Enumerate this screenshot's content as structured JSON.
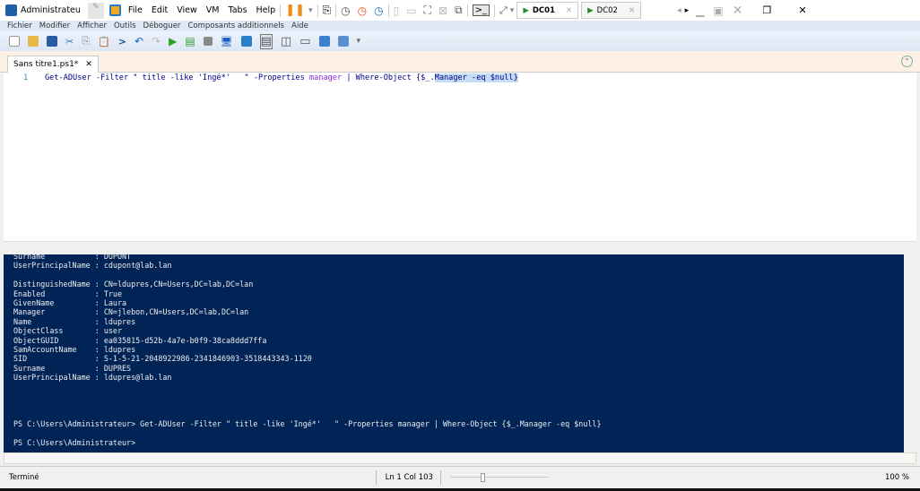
{
  "titlebar": {
    "app_title": "Administrateu",
    "menus": [
      "File",
      "Edit",
      "View",
      "VM",
      "Tabs",
      "Help"
    ],
    "vm_tabs": [
      {
        "label": "DC01",
        "active": true
      },
      {
        "label": "DC02",
        "active": false
      }
    ]
  },
  "menubar": {
    "items": [
      "Fichier",
      "Modifier",
      "Afficher",
      "Outils",
      "Déboguer",
      "Composants additionnels",
      "Aide"
    ]
  },
  "tab": {
    "label": "Sans titre1.ps1*"
  },
  "editor": {
    "line_number": "1",
    "code_parts": [
      "Get-ADUser -Filter \" title -like 'Ingé*'   \" -Properties ",
      "manager",
      " | ",
      "Where-Object",
      " {$_.",
      "Manager -eq $null}"
    ]
  },
  "console": {
    "lines": [
      "Surname           : DUPONT",
      "UserPrincipalName : cdupont@lab.lan",
      "",
      "DistinguishedName : CN=ldupres,CN=Users,DC=lab,DC=lan",
      "Enabled           : True",
      "GivenName         : Laura",
      "Manager           : CN=jlebon,CN=Users,DC=lab,DC=lan",
      "Name              : ldupres",
      "ObjectClass       : user",
      "ObjectGUID        : ea035815-d52b-4a7e-b0f9-38ca8ddd7ffa",
      "SamAccountName    : ldupres",
      "SID               : S-1-5-21-2048922986-2341846903-3518443343-1120",
      "Surname           : DUPRES",
      "UserPrincipalName : ldupres@lab.lan",
      "",
      "",
      "",
      "",
      "PS C:\\Users\\Administrateur> Get-ADUser -Filter \" title -like 'Ingé*'   \" -Properties manager | Where-Object {$_.Manager -eq $null}",
      "",
      "PS C:\\Users\\Administrateur>"
    ]
  },
  "status": {
    "text": "Terminé",
    "position": "Ln 1  Col 103",
    "zoom": "100 %",
    "zoom_level_percent": 100
  },
  "colors": {
    "console_bg": "#012456",
    "selection": "#c5dcf5"
  }
}
